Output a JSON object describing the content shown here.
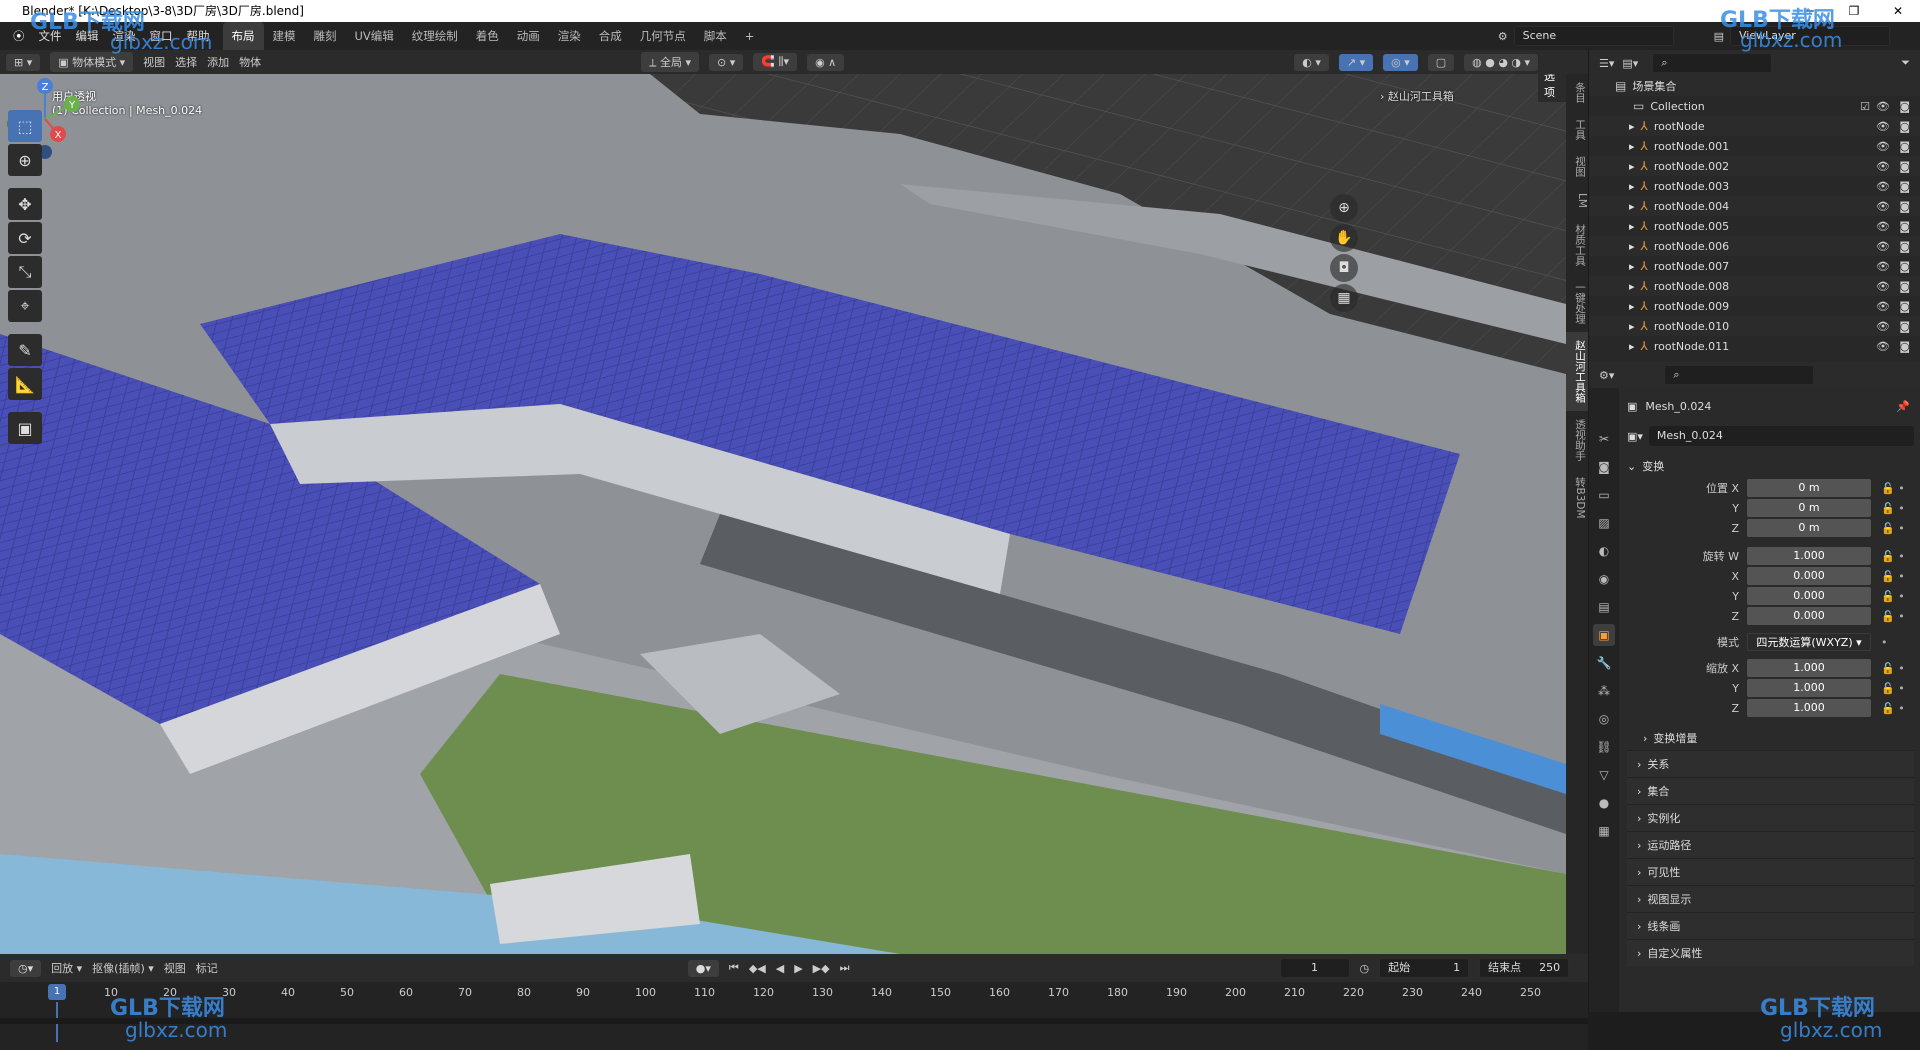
{
  "window": {
    "title": "Blender* [K:\\Desktop\\3-8\\3D厂房\\3D厂房.blend]",
    "controls": [
      "─",
      "❐",
      "✕"
    ]
  },
  "menu": [
    "文件",
    "编辑",
    "渲染",
    "窗口",
    "帮助"
  ],
  "workspaces": [
    "布局",
    "建模",
    "雕刻",
    "UV编辑",
    "纹理绘制",
    "着色",
    "动画",
    "渲染",
    "合成",
    "几何节点",
    "脚本",
    "+"
  ],
  "active_workspace": "布局",
  "scene": {
    "label": "Scene",
    "viewlayer": "ViewLayer"
  },
  "viewport_header": {
    "mode": "物体模式",
    "menus": [
      "视图",
      "选择",
      "添加",
      "物体"
    ],
    "transform": "全局",
    "options": "选项"
  },
  "viewport": {
    "view_label": "用户透视",
    "collection_label": "(1) Collection | Mesh_0.024",
    "toolbox": "赵山河工具箱"
  },
  "npanel_tabs": [
    "条目",
    "工具",
    "视图",
    "LM",
    "材质工具",
    "一键处理",
    "赵山河工具箱",
    "透视助手",
    "转B3DM"
  ],
  "gizmo": {
    "z": "Z",
    "y": "Y",
    "x": "X"
  },
  "outliner": {
    "root": "场景集合",
    "collection": "Collection",
    "items": [
      "rootNode",
      "rootNode.001",
      "rootNode.002",
      "rootNode.003",
      "rootNode.004",
      "rootNode.005",
      "rootNode.006",
      "rootNode.007",
      "rootNode.008",
      "rootNode.009",
      "rootNode.010",
      "rootNode.011"
    ]
  },
  "properties": {
    "object": "Mesh_0.024",
    "mesh": "Mesh_0.024",
    "transform_label": "变换",
    "location": {
      "label": "位置 X",
      "x": "0 m",
      "y": "0 m",
      "z": "0 m"
    },
    "rotation": {
      "label": "旋转 W",
      "w": "1.000",
      "x": "0.000",
      "y": "0.000",
      "z": "0.000"
    },
    "mode": {
      "label": "模式",
      "value": "四元数运算(WXYZ)"
    },
    "scale": {
      "label": "缩放 X",
      "x": "1.000",
      "y": "1.000",
      "z": "1.000"
    },
    "axis": {
      "x": "X",
      "y": "Y",
      "z": "Z"
    },
    "delta": "变换增量",
    "sections": [
      "关系",
      "集合",
      "实例化",
      "运动路径",
      "可见性",
      "视图显示",
      "线条画",
      "自定义属性"
    ]
  },
  "timeline": {
    "menus": [
      "回放",
      "抠像(插帧)",
      "视图",
      "标记"
    ],
    "current_frame": "1",
    "start_label": "起始",
    "start": "1",
    "end_label": "结束点",
    "end": "250",
    "ticks": [
      "10",
      "20",
      "30",
      "40",
      "50",
      "60",
      "70",
      "80",
      "90",
      "100",
      "110",
      "120",
      "130",
      "140",
      "150",
      "160",
      "170",
      "180",
      "190",
      "200",
      "210",
      "220",
      "230",
      "240",
      "250"
    ],
    "marker": "1"
  },
  "watermark": {
    "brand": "GLB下载网",
    "url": "glbxz.com"
  }
}
